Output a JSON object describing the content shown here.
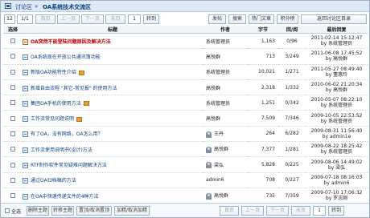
{
  "breadcrumb": {
    "forum": "讨论区",
    "separator": "»",
    "board": "OA系统技术交流区"
  },
  "pager": {
    "page_info": "12",
    "page_current": "1/1",
    "first": "首页",
    "prev": "上一页",
    "next": "下一页",
    "last": "末页",
    "page_input": "1",
    "goto": "转到"
  },
  "actions": {
    "post": "发帖",
    "search": "搜索",
    "hot": "热门文章",
    "points": "积分榜",
    "back": "返回讨论区目录"
  },
  "columns": {
    "select": "选择",
    "title": "标题",
    "author": "作者",
    "bytes": "字节",
    "replies": "回/阅",
    "last": "最后回复"
  },
  "topics": [
    {
      "title": "OA突然不能登陆问题原因及解决方法",
      "tag": "",
      "hot": true,
      "red": true,
      "pin": false,
      "author": "系统管理员",
      "avatar": false,
      "bytes": "1,163",
      "replies": "0/96",
      "last_date": "2011-02-14 15:12:47",
      "last_by": "by 系统管理员"
    },
    {
      "title": "OA系统现在开放公共通讯簿功能",
      "tag": "",
      "hot": false,
      "red": false,
      "pin": false,
      "author": "高悦群",
      "avatar": false,
      "bytes": "713",
      "replies": "3/249",
      "last_date": "2011-06-08 17:45:52",
      "last_by": "by 高悦群"
    },
    {
      "title": "新版OA功能特性介绍",
      "tag": "",
      "hot": false,
      "red": false,
      "pin": true,
      "author": "系统管理员",
      "avatar": false,
      "bytes": "10,021",
      "replies": "1/271",
      "last_date": "2011-05-27 08:49:40",
      "last_by": "by 董惠玲"
    },
    {
      "title": "新增自由流程 \"其它-常见报\" 的使用方法",
      "tag": "",
      "hot": false,
      "red": false,
      "pin": false,
      "author": "高悦群",
      "avatar": false,
      "bytes": "2,318",
      "replies": "1/332",
      "last_date": "2010-06-02 21:20:34",
      "last_by": "by 高悦群"
    },
    {
      "title": "集团OA手机的使用方法",
      "tag": "",
      "hot": false,
      "red": false,
      "pin": true,
      "author": "系统管理员",
      "avatar": false,
      "bytes": "1,251",
      "replies": "0/342",
      "last_date": "2010-05-07 08:22:10",
      "last_by": "by 系统管理员"
    },
    {
      "title": "工作流常见问题说明",
      "tag": "",
      "hot": false,
      "red": false,
      "pin": true,
      "author": "高悦群",
      "avatar": false,
      "bytes": "7,509",
      "replies": "7/346",
      "last_date": "2009-10-05 22:53:52",
      "last_by": "by 系统管理员"
    },
    {
      "title": "有了OA，没有网络，OA怎么用？",
      "tag": "",
      "hot": false,
      "red": false,
      "pin": false,
      "author": "王丹",
      "avatar": true,
      "bytes": "264",
      "replies": "6/282",
      "last_date": "2009-08-31 11:56:40",
      "last_by": "by admin1e"
    },
    {
      "title": "工作流使用说明书(设计)方法",
      "tag": "",
      "hot": false,
      "red": false,
      "pin": false,
      "author": "高悦群",
      "avatar": true,
      "bytes": "7,377",
      "replies": "1/281",
      "last_date": "2009-08-22 18:25:42",
      "last_by": "by 系统管理员"
    },
    {
      "title": "RTF制作软件常见疑难问题解决方法",
      "tag": "",
      "hot": false,
      "red": false,
      "pin": false,
      "author": "梁弘",
      "avatar": true,
      "bytes": "5,828",
      "replies": "0/225",
      "last_date": "2009-08-06 14:49:02",
      "last_by": "by 梁弘"
    },
    {
      "title": "通过OA归档稿的方法",
      "tag": "",
      "hot": false,
      "red": false,
      "pin": false,
      "author": "admin6",
      "avatar": false,
      "bytes": "708",
      "replies": "0/227",
      "last_date": "2009-07-18 08:16:03",
      "last_by": "by admin6"
    },
    {
      "title": "在OA中快速传递文件的4种方法",
      "tag": "",
      "hot": false,
      "red": false,
      "pin": false,
      "author": "高悦群",
      "avatar": true,
      "bytes": "735",
      "replies": "7/359",
      "last_date": "2009-07-10 17:06:32",
      "last_by": "by 罗志刚"
    },
    {
      "title": "OA系统实用技巧---用OA撤邮来OA的方法",
      "tag": "",
      "hot": false,
      "red": false,
      "pin": false,
      "author": "高悦群",
      "avatar": true,
      "bytes": "415",
      "replies": "4/219",
      "last_date": "2009-07-10 09:07:13",
      "last_by": "by 高悦群"
    }
  ],
  "footer": {
    "select_all": "全选",
    "delete": "删除主题",
    "move": "转移主题",
    "pin": "置顶/取消置顶",
    "highlight": "加精/取消加精",
    "first": "首页",
    "prev": "上一页",
    "next": "下一页",
    "last": "末页",
    "page_input": "1",
    "goto": "转到"
  }
}
